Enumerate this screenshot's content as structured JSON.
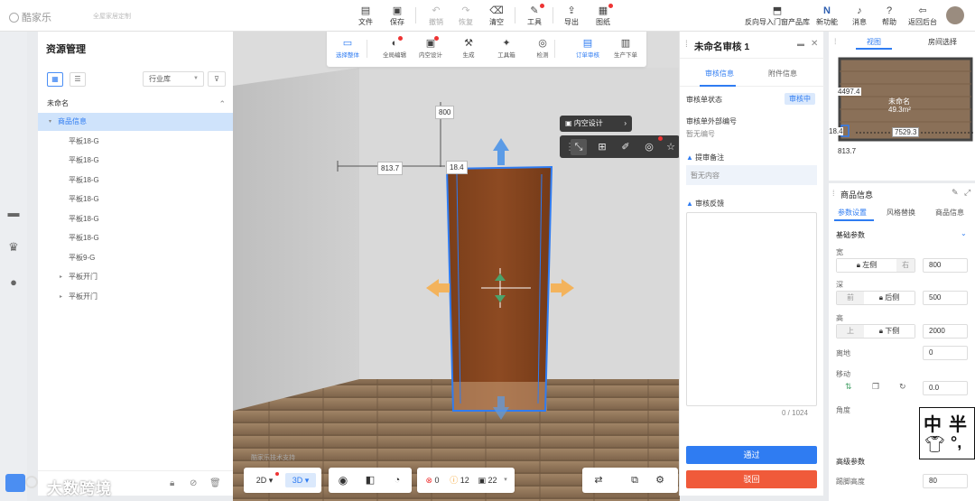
{
  "app": {
    "logo": "酷家乐",
    "subtitle": "全屋家居定制"
  },
  "toolbar": {
    "file": "文件",
    "save": "保存",
    "undo": "撤销",
    "redo": "恢复",
    "clear": "清空",
    "tools": "工具",
    "export": "导出",
    "drawings": "图纸",
    "reverse_import": "反向导入门窗产品库",
    "new_feature": "新功能",
    "messages": "消息",
    "help": "帮助",
    "back_admin": "返回后台"
  },
  "resource": {
    "title": "资源管理",
    "library": "行业库",
    "root": "未命名",
    "tree": [
      {
        "label": "商品信息",
        "level": 1,
        "selected": true
      },
      {
        "label": "平板18-G",
        "level": 2
      },
      {
        "label": "平板18-G",
        "level": 2
      },
      {
        "label": "平板18-G",
        "level": 2
      },
      {
        "label": "平板18-G",
        "level": 2
      },
      {
        "label": "平板18-G",
        "level": 2
      },
      {
        "label": "平板18-G",
        "level": 2
      },
      {
        "label": "平板9-G",
        "level": 2
      },
      {
        "label": "平板开门",
        "level": 2,
        "arrow": true
      },
      {
        "label": "平板开门",
        "level": 2,
        "arrow": true
      }
    ]
  },
  "tools2": [
    {
      "label": "选择整体",
      "active": true
    },
    {
      "label": "全局编辑",
      "dot": true
    },
    {
      "label": "内空设计",
      "dot": true
    },
    {
      "label": "生成"
    },
    {
      "label": "工具箱"
    },
    {
      "label": "检测"
    },
    {
      "label": "订单审核",
      "active": true
    },
    {
      "label": "生产下单"
    }
  ],
  "scene": {
    "dim_top": "800",
    "dim_left": "813.7",
    "dim_mid": "18.4",
    "inner_design_label": "内空设计",
    "watermark": "酷家乐技术支持"
  },
  "bottom": {
    "mode2d": "2D",
    "mode3d": "3D",
    "err": "0",
    "warn": "12",
    "count": "22"
  },
  "audit": {
    "title": "未命名审核 1",
    "tab_info": "审核信息",
    "tab_attach": "附件信息",
    "status_label": "审核单状态",
    "status_value": "审核中",
    "ext_no_label": "审核单外部编号",
    "ext_no_value": "暂无编号",
    "remark_label": "提审备注",
    "remark_value": "暂无内容",
    "feedback_label": "审核反馈",
    "counter": "0 / 1024",
    "pass": "通过",
    "reject": "驳回"
  },
  "viewpanel": {
    "tab_view": "视图",
    "tab_room": "房间选择",
    "room_name": "未命名",
    "room_area": "49.3m²",
    "d1": "4497.4",
    "d2": "7529.3",
    "d3": "813.7",
    "d4": "18.4"
  },
  "product": {
    "title": "商品信息",
    "tab_params": "参数设置",
    "tab_style": "风格替换",
    "tab_goods": "商品信息",
    "section": "基础参数",
    "width_label": "宽",
    "width_left": "左侧",
    "width_right": "右",
    "width_value": "800",
    "depth_label": "深",
    "depth_front": "前",
    "depth_back": "后侧",
    "depth_value": "500",
    "height_label": "高",
    "height_up": "上",
    "height_down": "下侧",
    "height_value": "2000",
    "ground_label": "离地",
    "ground_value": "0",
    "move_label": "移动",
    "move_value": "0.0",
    "angle_label": "角度",
    "adv_section": "高级参数",
    "kick_label": "踢脚高度",
    "kick_value": "80"
  },
  "watermark_text": "大数跨境",
  "stamp": {
    "t1": "中",
    "t2": "半",
    "t3": "°,"
  }
}
